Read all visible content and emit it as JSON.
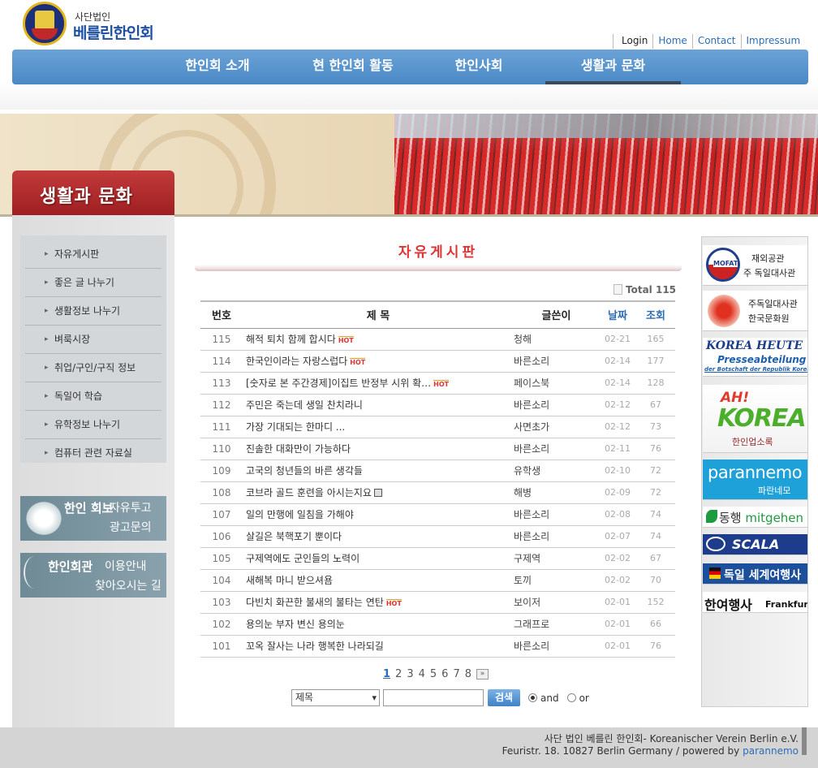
{
  "logo": {
    "small": "사단법인",
    "big": "베를린한인회"
  },
  "toplinks": [
    "Login",
    "Home",
    "Contact",
    "Impressum"
  ],
  "nav": [
    "한인회 소개",
    "현 한인회 활동",
    "한인사회",
    "생활과 문화"
  ],
  "nav_active_index": 3,
  "section_title": "생활과 문화",
  "submenu": [
    "자유게시판",
    "좋은 글 나누기",
    "생활정보 나누기",
    "벼룩시장",
    "취업/구인/구직 정보",
    "독일어 학습",
    "유학정보 나누기",
    "컴퓨터 관련 자료실"
  ],
  "sidebanner1": {
    "t1": "한인 회보",
    "t2": "자유투고",
    "t3": "광고문의"
  },
  "sidebanner2": {
    "t1": "한인회관",
    "t2": "이용안내",
    "t3": "찾아오시는 길"
  },
  "board": {
    "title": "자유게시판",
    "total_label": "Total",
    "total": "115",
    "headers": {
      "num": "번호",
      "subject": "제    목",
      "writer": "글쓴이",
      "date": "날짜",
      "views": "조회"
    },
    "hot_label": "HOT",
    "rows": [
      {
        "num": "115",
        "subject": "해적 퇴치 함께 합시다",
        "hot": true,
        "file": false,
        "writer": "청해",
        "date": "02-21",
        "views": "165"
      },
      {
        "num": "114",
        "subject": "한국인이라는 자랑스럽다",
        "hot": true,
        "file": false,
        "writer": "바른소리",
        "date": "02-14",
        "views": "177"
      },
      {
        "num": "113",
        "subject": "[숫자로 본 주간경제]이집트 반정부 시위 확…",
        "hot": true,
        "file": false,
        "writer": "페이스북",
        "date": "02-14",
        "views": "128"
      },
      {
        "num": "112",
        "subject": "주민은 죽는데 생일 찬치라니",
        "hot": false,
        "file": false,
        "writer": "바른소리",
        "date": "02-12",
        "views": "67"
      },
      {
        "num": "111",
        "subject": "가장 기대되는 한마디 ...",
        "hot": false,
        "file": false,
        "writer": "사면초가",
        "date": "02-12",
        "views": "73"
      },
      {
        "num": "110",
        "subject": "진솔한 대화만이 가능하다",
        "hot": false,
        "file": false,
        "writer": "바른소리",
        "date": "02-11",
        "views": "76"
      },
      {
        "num": "109",
        "subject": "고국의 청년들의 바른 생각들",
        "hot": false,
        "file": false,
        "writer": "유학생",
        "date": "02-10",
        "views": "72"
      },
      {
        "num": "108",
        "subject": "코브라 골드 훈련을 아시는지요",
        "hot": false,
        "file": true,
        "writer": "해병",
        "date": "02-09",
        "views": "72"
      },
      {
        "num": "107",
        "subject": "일의 만행에 일침을 가해야",
        "hot": false,
        "file": false,
        "writer": "바른소리",
        "date": "02-08",
        "views": "74"
      },
      {
        "num": "106",
        "subject": "살길은 북핵포기 뿐이다",
        "hot": false,
        "file": false,
        "writer": "바른소리",
        "date": "02-07",
        "views": "74"
      },
      {
        "num": "105",
        "subject": "구제역에도 군인들의 노력이",
        "hot": false,
        "file": false,
        "writer": "구제역",
        "date": "02-02",
        "views": "67"
      },
      {
        "num": "104",
        "subject": "새해복 마니 받으셔욤",
        "hot": false,
        "file": false,
        "writer": "토끼",
        "date": "02-02",
        "views": "70"
      },
      {
        "num": "103",
        "subject": "다빈치 화끈한 불새의 불타는 연탄",
        "hot": true,
        "file": false,
        "writer": "보이저",
        "date": "02-01",
        "views": "152"
      },
      {
        "num": "102",
        "subject": "용의눈 부자 변신 용의눈",
        "hot": false,
        "file": false,
        "writer": "그래프로",
        "date": "02-01",
        "views": "66"
      },
      {
        "num": "101",
        "subject": "꼬옥 잘사는 나라 행복한 나라되길",
        "hot": false,
        "file": false,
        "writer": "바른소리",
        "date": "02-01",
        "views": "76"
      }
    ]
  },
  "pager": {
    "pages": [
      "1",
      "2",
      "3",
      "4",
      "5",
      "6",
      "7",
      "8"
    ],
    "current": "1",
    "next": "»"
  },
  "search": {
    "select_value": "제목",
    "button": "검색",
    "and_label": "and",
    "or_label": "or"
  },
  "right_banners": {
    "mofat": {
      "logo": "MOFAT",
      "l1": "재외공관",
      "l2": "주 독일대사관"
    },
    "culture": {
      "l1": "주독일대사관",
      "l2": "한국문화원"
    },
    "heute": {
      "l1": "KOREA HEUTE",
      "l2": "Presseabteilung",
      "l3": "der Botschaft der Republik Korea"
    },
    "ahkorea": {
      "l1": "AH!",
      "l2": "KOREA",
      "l3": "한인업소록"
    },
    "parannemo": {
      "l1": "parannemo",
      "l2": "파란네모"
    },
    "donghaeng": {
      "l1a": "동행",
      "l1b": "mitgehen"
    },
    "scala": {
      "l1": "SCALA"
    },
    "segye": {
      "l1": "독일 세계여행사"
    },
    "hanyeo": {
      "l1": "한여행사",
      "l2": "Frankfurt"
    }
  },
  "footer": {
    "line1": "사단 법인 베를린 한인회- Koreanischer Verein Berlin e.V.",
    "line2": "Feuristr. 18. 10827 Berlin Germany / powered by",
    "powered": "parannemo"
  }
}
